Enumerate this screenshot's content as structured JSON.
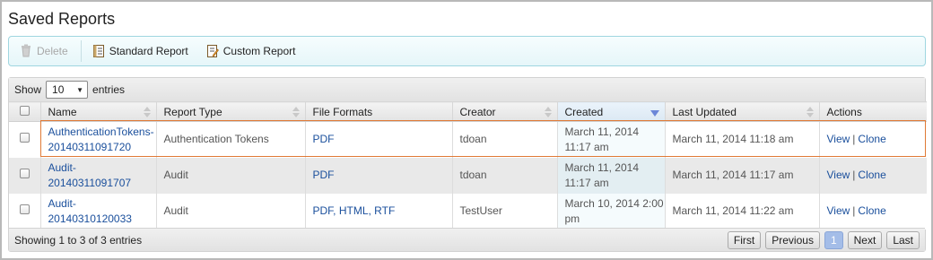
{
  "page": {
    "title": "Saved Reports"
  },
  "toolbar": {
    "delete_label": "Delete",
    "standard_label": "Standard Report",
    "custom_label": "Custom Report"
  },
  "grid": {
    "show_label": "Show",
    "page_size": "10",
    "entries_label": "entries",
    "columns": [
      "Name",
      "Report Type",
      "File Formats",
      "Creator",
      "Created",
      "Last Updated",
      "Actions"
    ],
    "rows": [
      {
        "name_line1": "AuthenticationTokens-",
        "name_line2": "20140311091720",
        "type": "Authentication Tokens",
        "formats": "PDF",
        "creator": "tdoan",
        "created_line1": "March 11, 2014",
        "created_line2": "11:17 am",
        "updated": "March 11, 2014 11:18 am",
        "view": "View",
        "clone": "Clone"
      },
      {
        "name_line1": "Audit-",
        "name_line2": "20140311091707",
        "type": "Audit",
        "formats": "PDF",
        "creator": "tdoan",
        "created_line1": "March 11, 2014",
        "created_line2": "11:17 am",
        "updated": "March 11, 2014 11:17 am",
        "view": "View",
        "clone": "Clone"
      },
      {
        "name_line1": "Audit-",
        "name_line2": "20140310120033",
        "type": "Audit",
        "formats": "PDF, HTML, RTF",
        "creator": "TestUser",
        "created_line1": "March 10, 2014 2:00",
        "created_line2": "pm",
        "updated": "March 11, 2014 11:22 am",
        "view": "View",
        "clone": "Clone"
      }
    ],
    "info": "Showing 1 to 3 of 3 entries",
    "pager": {
      "first": "First",
      "previous": "Previous",
      "current": "1",
      "next": "Next",
      "last": "Last"
    }
  },
  "colors": {
    "accent": "#1a4f9c",
    "selection_border": "#e07a36",
    "toolbar_border": "#9fd6e0",
    "current_page": "#a4bde8"
  }
}
